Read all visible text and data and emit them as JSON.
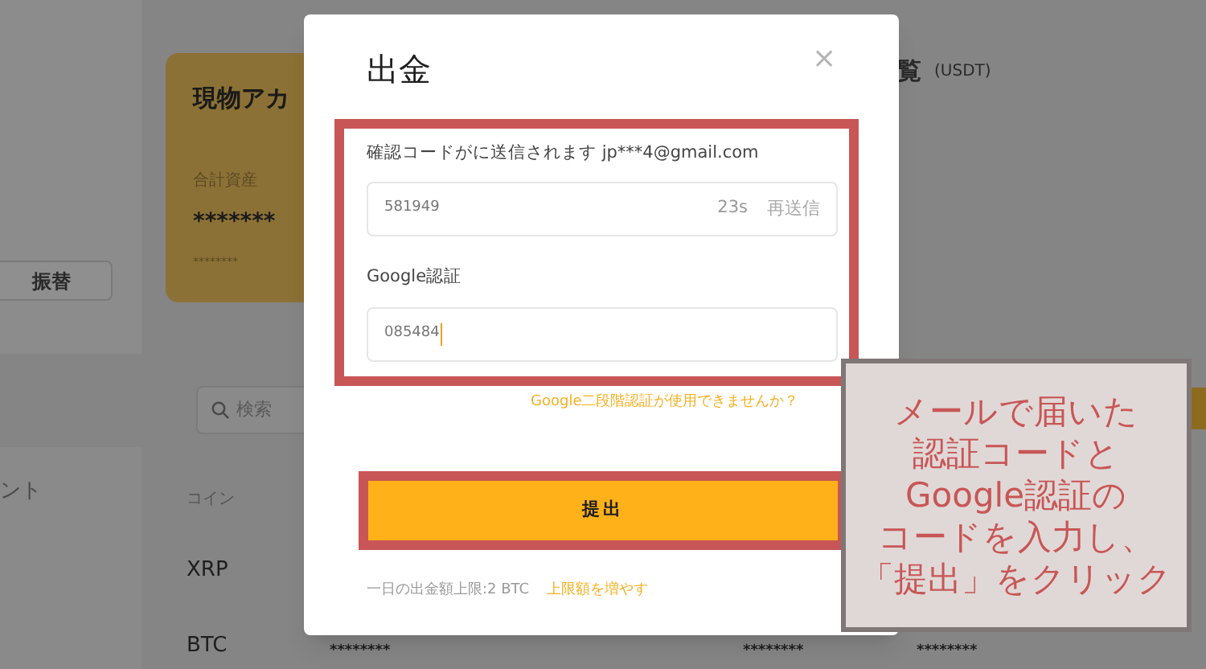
{
  "background": {
    "transfer_button": "振替",
    "card": {
      "title": "現物アカ",
      "total_label": "合計資産",
      "total_value": "*******",
      "sub_value": "********"
    },
    "side_text": "ント",
    "search": {
      "placeholder": "検索"
    },
    "column_header": "コイン",
    "coins": [
      "XRP",
      "BTC"
    ],
    "btc_values": [
      "********",
      "********",
      "********"
    ],
    "overview_title": "覧",
    "overview_unit": "(USDT)"
  },
  "dialog": {
    "title": "出金",
    "close": "×",
    "code_label": "確認コードがに送信されます jp***4@gmail.com",
    "code_value": "581949",
    "countdown": "23s",
    "resend": "再送信",
    "google_label": "Google認証",
    "google_value": "085484",
    "help_link": "Google二段階認証が使用できませんか？",
    "submit": "提出",
    "limit_text": "一日の出金額上限:2 BTC",
    "limit_link": "上限額を増やす"
  },
  "annotation": {
    "lines": [
      "メールで届いた",
      "認証コードと",
      "Google認証の",
      "コードを入力し、",
      "「提出」をクリック"
    ]
  }
}
